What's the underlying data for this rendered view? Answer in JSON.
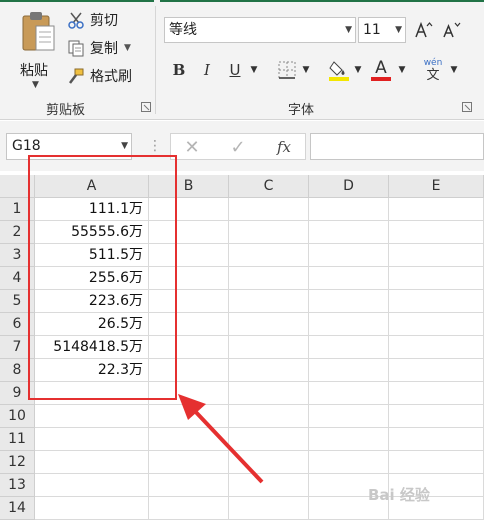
{
  "clipboard": {
    "paste_label": "粘贴",
    "cut_label": "剪切",
    "copy_label": "复制",
    "format_painter_label": "格式刷",
    "group_label": "剪贴板"
  },
  "font": {
    "font_name": "等线",
    "font_size": "11",
    "bold": "B",
    "italic": "I",
    "underline": "U",
    "font_color_letter": "A",
    "phonetic_glyph": "wén",
    "phonetic_char": "文",
    "group_label": "字体",
    "font_color": "#e02020",
    "fill_color": "#f3e600"
  },
  "formula_bar": {
    "name_box": "G18",
    "fx_label": "fx"
  },
  "columns": [
    "A",
    "B",
    "C",
    "D",
    "E"
  ],
  "rows": [
    "1",
    "2",
    "3",
    "4",
    "5",
    "6",
    "7",
    "8",
    "9",
    "10",
    "11",
    "12",
    "13",
    "14"
  ],
  "column_a_values": [
    "111.1万",
    "55555.6万",
    "511.5万",
    "255.6万",
    "223.6万",
    "26.5万",
    "5148418.5万",
    "22.3万"
  ],
  "watermark": "Bai 经验",
  "accent_color": "#217346",
  "annotation_color": "#e53030"
}
